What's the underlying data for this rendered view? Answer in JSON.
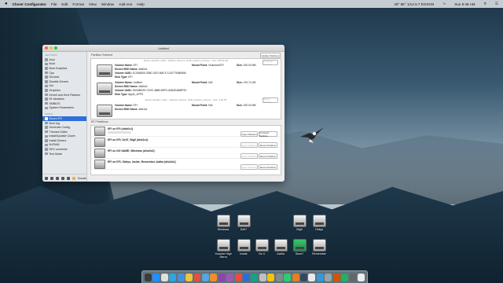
{
  "menubar": {
    "items": [
      "Clover Configurator",
      "File",
      "Edit",
      "Format",
      "View",
      "Window",
      "Add-ons",
      "Help"
    ],
    "status": "49° 85° 1/13 6.7 EOSGN",
    "clock": "Sun 9:48 AM"
  },
  "window": {
    "title": "Untitled",
    "sidebar": {
      "sections_header": "SECTIONS",
      "sections": [
        "Acpi",
        "Boot",
        "Boot Graphics",
        "Cpu",
        "Devices",
        "Disable Drivers",
        "Gui",
        "Graphics",
        "Kernel and Kext Patches",
        "Rt Variables",
        "SMBIOS",
        "System Parameters"
      ],
      "tools_header": "TOOLS",
      "tools": [
        "Mount EFI",
        "Boot log",
        "Generate Config",
        "Themes Editor",
        "Install/Update Clover",
        "Install Drivers",
        "NVRAM",
        "HEX converter",
        "Text Mode"
      ],
      "selected": "Mount EFI",
      "footer_donate": "Donate"
    },
    "partition_scheme_label": "Partition Scheme",
    "update_button": "Update Partitions",
    "partitions": [
      {
        "header": "Device Identifier: disk0 – Partition Scheme: GUID_partition_scheme – Size: 256.06 GB",
        "volume_name": "EFI",
        "bsd_name": "disk0s1",
        "uuid": "3C0D8828-7B6D-3197-B8CF-1C8777B9B4B8",
        "disk_type": "EFI",
        "mount_point": "/Volumes/EFI",
        "size": "200.00 MB"
      },
      {
        "header": "",
        "volume_name": "Untitled",
        "bsd_name": "disk0s2",
        "uuid": "2BC8BD29-7CEE-4BB0-B9F0-A984E4658F93",
        "disk_type": "Apple_APFS",
        "mount_point": "N/A",
        "size": "476.74 GB"
      },
      {
        "header": "Device Identifier: disk1 – Partition Scheme: GUID_partition_scheme – Size: 1.82 TB",
        "volume_name": "EFI",
        "bsd_name": "disk1s1",
        "uuid": "",
        "disk_type": "",
        "mount_point": "N/A",
        "size": "200.00 MB"
      }
    ],
    "labels": {
      "volume_name": "Volume Name:",
      "bsd_name": "Device BSD Name:",
      "uuid": "Volume UUID:",
      "disk_type": "Disk Type:",
      "mount_point": "Mount Point:",
      "size": "Size:",
      "open_button": "Open Partition",
      "mount_button": "Mount Partition",
      "unmount_button": "Unmount Partition"
    },
    "efi_label": "EFI Partitions",
    "efi_list": [
      "EFI on EFI (disk0s1)",
      "EFI on EFI, Dell7, Big5 (disk1s1)",
      "EFI on NO NAME, Windows (disk2s2)",
      "EFI on EFI, Obitys, Inside, Remember, Aatha (disk3s1)"
    ]
  },
  "desktop_icons": [
    {
      "label": "Windows",
      "green": false
    },
    {
      "label": "Dell7",
      "green": false
    },
    {
      "label": "Big5",
      "green": false
    },
    {
      "label": "Obitys",
      "green": false
    },
    {
      "label": "Youtube High Sierra",
      "green": false
    },
    {
      "label": "Inside",
      "green": false
    },
    {
      "label": "Os X",
      "green": false
    },
    {
      "label": "Aatha",
      "green": false
    },
    {
      "label": "Save7",
      "green": true
    },
    {
      "label": "Remember",
      "green": false
    }
  ],
  "dock_colors": [
    "#3c3c3c",
    "#1e90ff",
    "#e0e0e0",
    "#2aa8e0",
    "#4a90d9",
    "#f0c33c",
    "#e8503a",
    "#56a6e0",
    "#f18f2c",
    "#8e44ad",
    "#9b59b6",
    "#e74c3c",
    "#2c6fd1",
    "#16a085",
    "#c0c0c0",
    "#f1c40f",
    "#7f8c8d",
    "#2ecc71",
    "#e67e22",
    "#34495e",
    "#eaeaea",
    "#3498db",
    "#95a5a6",
    "#d35400",
    "#27ae60",
    "#666666",
    "#ededed"
  ],
  "colors": {
    "selection": "#2f6fd9",
    "traffic_red": "#ff5f57",
    "traffic_yellow": "#febc2e",
    "traffic_green": "#28c840"
  }
}
